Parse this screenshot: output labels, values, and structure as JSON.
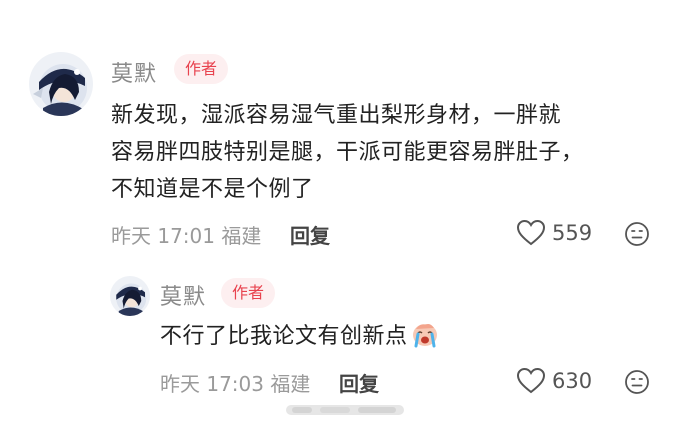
{
  "comment": {
    "author": "莫默",
    "badge": "作者",
    "lines": [
      "新发现，湿派容易湿气重出梨形身材，一胖就",
      "容易胖四肢特别是腿，干派可能更容易胖肚子，",
      "不知道是不是个例了"
    ],
    "time": "昨天 17:01",
    "location": "福建",
    "reply_label": "回复",
    "likes": "559",
    "icons": {
      "like": "heart-outline-icon",
      "dislike": "frown-face-icon"
    }
  },
  "reply": {
    "author": "莫默",
    "badge": "作者",
    "text": "不行了比我论文有创新点",
    "emoji": "crying-face-emoji",
    "time": "昨天 17:03",
    "location": "福建",
    "reply_label": "回复",
    "likes": "630",
    "icons": {
      "like": "heart-outline-icon",
      "dislike": "frown-face-icon"
    }
  },
  "colors": {
    "badge_bg": "#fdeff0",
    "badge_text": "#e8434f",
    "meta_text": "#9a9a9a",
    "body_text": "#222222"
  }
}
